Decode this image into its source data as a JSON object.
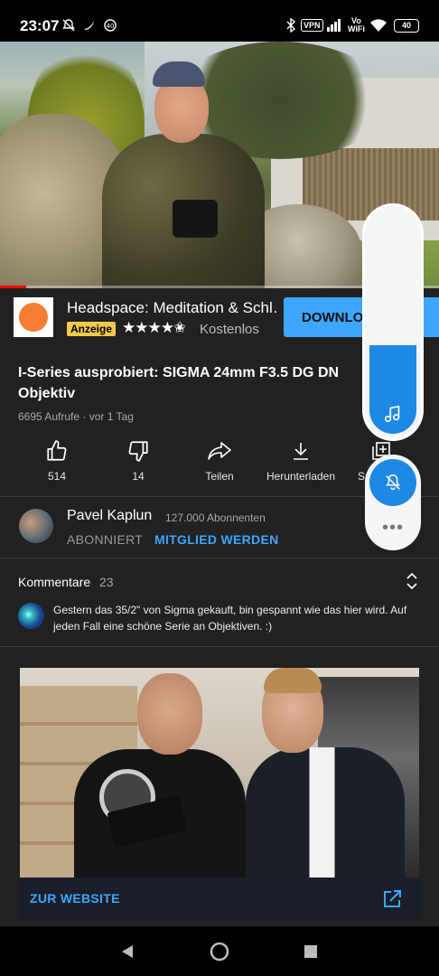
{
  "status_bar": {
    "time": "23:07",
    "vpn": "VPN",
    "volte_top": "Vo",
    "volte_bottom": "WiFi",
    "battery": "40",
    "icons": [
      "mute-icon",
      "bird-icon",
      "four-g-icon",
      "bluetooth-icon",
      "vpn-icon",
      "signal-icon",
      "vowifi-icon",
      "wifi-icon",
      "battery-icon"
    ]
  },
  "video": {
    "progress_fraction": 0.06,
    "progress_color": "#ff0000"
  },
  "ad": {
    "title": "Headspace: Meditation & Schl…",
    "badge": "Anzeige",
    "stars": "★★★★✬",
    "rating": 4.5,
    "price": "Kostenlos",
    "button": "DOWNLOAD"
  },
  "video_info": {
    "title": "I-Series ausprobiert: SIGMA 24mm F3.5 DG DN Objektiv",
    "meta": "6695 Aufrufe · vor 1 Tag"
  },
  "actions": [
    {
      "icon": "thumbs-up-icon",
      "label": "514"
    },
    {
      "icon": "thumbs-down-icon",
      "label": "14"
    },
    {
      "icon": "share-icon",
      "label": "Teilen"
    },
    {
      "icon": "download-icon",
      "label": "Herunterladen"
    },
    {
      "icon": "save-to-playlist-icon",
      "label": "Sp"
    }
  ],
  "channel": {
    "name": "Pavel Kaplun",
    "subscribers": "127.000 Abonnenten",
    "subscribed_label": "ABONNIERT",
    "join_label": "MITGLIED WERDEN"
  },
  "comments": {
    "label": "Kommentare",
    "count": "23",
    "top_comment": "Gestern das 35/2\" von Sigma gekauft, bin gespannt wie das hier wird. Auf jeden Fall eine schöne Serie an Objektiven. :)"
  },
  "promo": {
    "link_label": "ZUR WEBSITE"
  },
  "volume_overlay": {
    "level_fraction": 0.4,
    "accent": "#1e88e5"
  },
  "colors": {
    "background": "#212121",
    "accent": "#3ea6ff",
    "ad_badge": "#f2c94c"
  }
}
